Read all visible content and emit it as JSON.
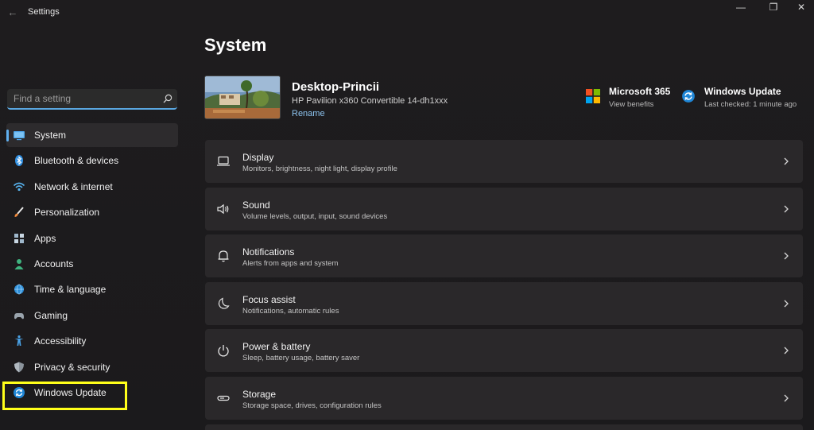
{
  "app": {
    "title": "Settings",
    "back_glyph": "←"
  },
  "window_controls": {
    "minimize": "—",
    "maximize": "❐",
    "close": "✕"
  },
  "search": {
    "placeholder": "Find a setting",
    "icon": "search-icon"
  },
  "sidebar": {
    "items": [
      {
        "label": "System",
        "icon": "system-monitor-icon",
        "active": true
      },
      {
        "label": "Bluetooth & devices",
        "icon": "bluetooth-icon"
      },
      {
        "label": "Network & internet",
        "icon": "wifi-icon"
      },
      {
        "label": "Personalization",
        "icon": "brush-icon"
      },
      {
        "label": "Apps",
        "icon": "apps-grid-icon"
      },
      {
        "label": "Accounts",
        "icon": "person-icon"
      },
      {
        "label": "Time & language",
        "icon": "globe-clock-icon"
      },
      {
        "label": "Gaming",
        "icon": "gamepad-icon"
      },
      {
        "label": "Accessibility",
        "icon": "accessibility-icon"
      },
      {
        "label": "Privacy & security",
        "icon": "shield-icon"
      },
      {
        "label": "Windows Update",
        "icon": "update-sync-icon",
        "highlighted": true
      }
    ]
  },
  "main": {
    "title": "System",
    "device": {
      "name": "Desktop-Princii",
      "model": "HP Pavilion x360 Convertible 14-dh1xxx",
      "rename": "Rename"
    },
    "quick_links": [
      {
        "title": "Microsoft 365",
        "subtitle": "View benefits",
        "icon": "microsoft-logo-icon"
      },
      {
        "title": "Windows Update",
        "subtitle": "Last checked: 1 minute ago",
        "icon": "update-sync-icon"
      }
    ],
    "cards": [
      {
        "title": "Display",
        "subtitle": "Monitors, brightness, night light, display profile",
        "icon": "laptop-icon"
      },
      {
        "title": "Sound",
        "subtitle": "Volume levels, output, input, sound devices",
        "icon": "speaker-icon"
      },
      {
        "title": "Notifications",
        "subtitle": "Alerts from apps and system",
        "icon": "bell-icon"
      },
      {
        "title": "Focus assist",
        "subtitle": "Notifications, automatic rules",
        "icon": "moon-icon"
      },
      {
        "title": "Power & battery",
        "subtitle": "Sleep, battery usage, battery saver",
        "icon": "power-icon"
      },
      {
        "title": "Storage",
        "subtitle": "Storage space, drives, configuration rules",
        "icon": "storage-drive-icon"
      }
    ]
  },
  "colors": {
    "accent": "#60b0f0",
    "highlight_box": "#ffff1a",
    "background": "#1c1c1c",
    "card": "#2a282a"
  }
}
